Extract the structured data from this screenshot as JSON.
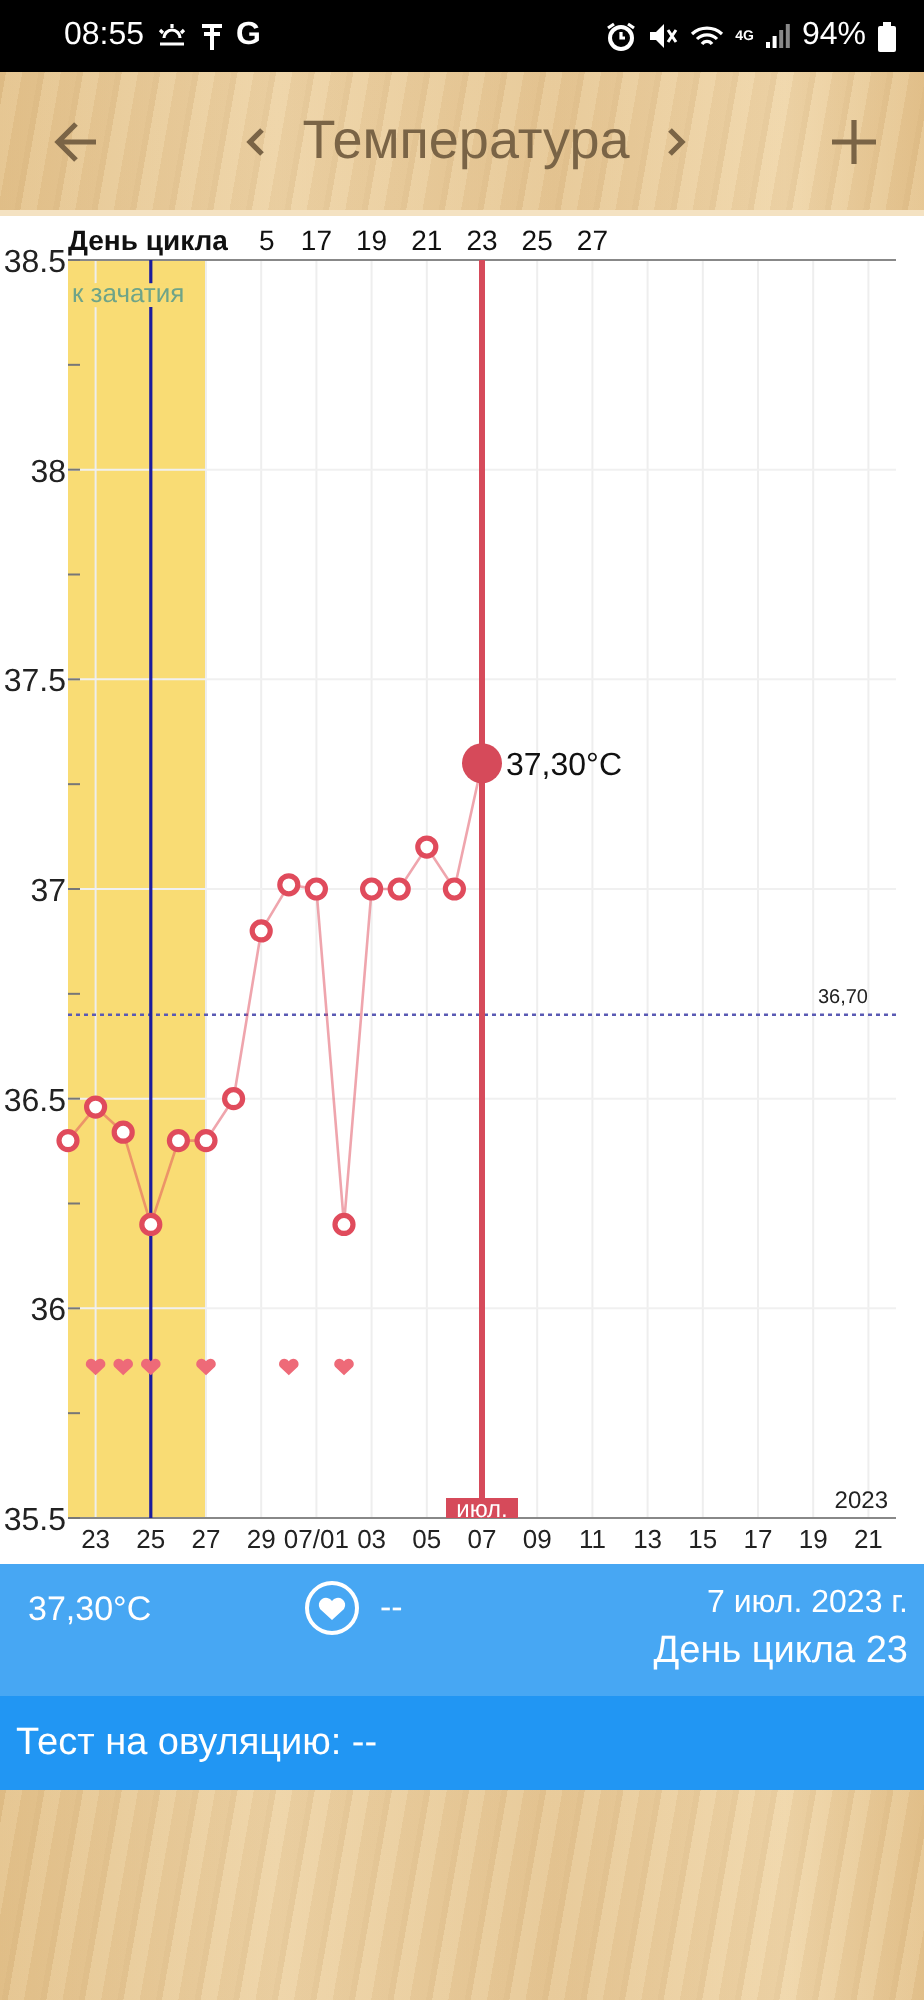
{
  "status_bar": {
    "time": "08:55",
    "carrier_letter": "G",
    "network": "4G",
    "battery": "94%"
  },
  "header": {
    "title": "Температура"
  },
  "chart": {
    "chart_data": {
      "type": "line",
      "grid": true,
      "ylim": [
        35.5,
        38.5
      ],
      "yticks": [
        {
          "value": 35.5,
          "label": "35.5"
        },
        {
          "value": 36,
          "label": "36"
        },
        {
          "value": 36.5,
          "label": "36.5"
        },
        {
          "value": 37,
          "label": "37"
        },
        {
          "value": 37.5,
          "label": "37.5"
        },
        {
          "value": 38,
          "label": "38"
        },
        {
          "value": 38.5,
          "label": "38.5"
        }
      ],
      "categories": [
        null,
        "23",
        null,
        "25",
        null,
        "27",
        null,
        "29",
        null,
        "07/01",
        null,
        "03",
        null,
        "05",
        null,
        "07",
        null,
        "09",
        null,
        "11",
        null,
        "13",
        null,
        "15",
        null,
        "17",
        null,
        "19",
        null,
        "21",
        null
      ],
      "series": [
        {
          "color": "#e04b5c",
          "marker": "o",
          "values": [
            36.4,
            36.48,
            36.42,
            36.2,
            36.4,
            36.4,
            36.5,
            36.9,
            37.01,
            37.0,
            36.2,
            37.0,
            37.0,
            37.1,
            37.0,
            37.3,
            null,
            null,
            null,
            null,
            null,
            null,
            null,
            null,
            null,
            null,
            null,
            null,
            null,
            null,
            null
          ]
        },
        {
          "type": "scatter",
          "color": "#ee6a78",
          "values": [
            null,
            35.85,
            35.85,
            35.85,
            null,
            35.85,
            null,
            null,
            35.85,
            null,
            35.85,
            null,
            null,
            null,
            null,
            null,
            null,
            null,
            null,
            null,
            null,
            null,
            null,
            null,
            null,
            null,
            null,
            null,
            null,
            null,
            null
          ]
        }
      ],
      "ref_lines": [
        {
          "axis": "y",
          "value": 36.7,
          "label": "36,70",
          "color": "#5a5ab4"
        },
        {
          "axis": "x",
          "value": "25",
          "color": "#1c1c9c"
        },
        {
          "axis": "x",
          "value": "07",
          "color": "#d64a5a",
          "label": "июл."
        }
      ],
      "annotations": [
        {
          "text": "37,30°C",
          "x": "07",
          "y": 37.3
        },
        "2023"
      ]
    },
    "fertile_window": {
      "label": "к зачатия",
      "color": "#f9dc74"
    },
    "cycle_axis": {
      "title": "День цикла",
      "labels": [
        "5",
        "17",
        "19",
        "21",
        "23",
        "25",
        "27"
      ]
    }
  },
  "day_info": {
    "temperature": "37,30°C",
    "intercourse": "--",
    "date": "7 июл. 2023 г.",
    "cycle_day": "День цикла 23"
  },
  "ovulation_test": {
    "label": "Тест на овуляцию: --"
  }
}
